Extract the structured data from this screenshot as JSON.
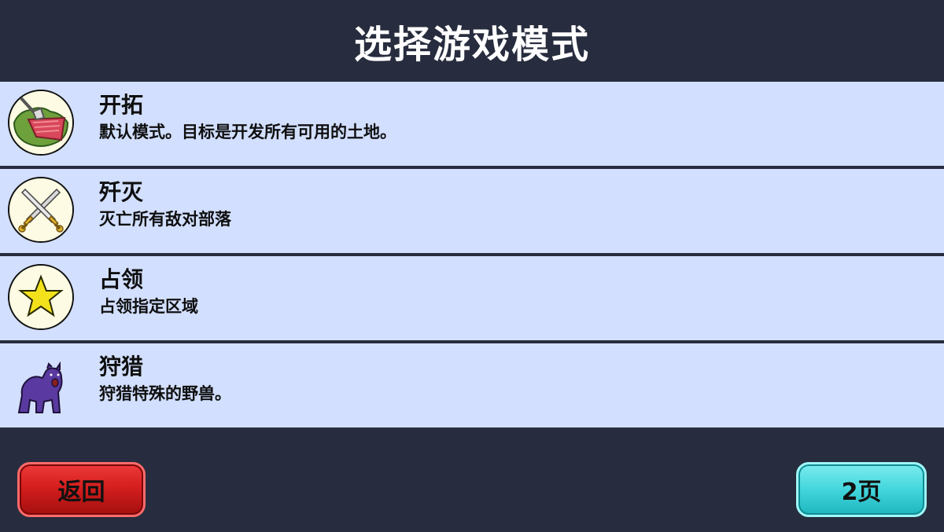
{
  "header": {
    "title": "选择游戏模式"
  },
  "modes": [
    {
      "name": "开拓",
      "description": "默认模式。目标是开发所有可用的土地。",
      "icon": "land-development-icon"
    },
    {
      "name": "歼灭",
      "description": "灭亡所有敌对部落",
      "icon": "crossed-swords-icon"
    },
    {
      "name": "占领",
      "description": "占领指定区域",
      "icon": "star-icon"
    },
    {
      "name": "狩猎",
      "description": "狩猎特殊的野兽。",
      "icon": "bear-icon"
    }
  ],
  "footer": {
    "back_label": "返回",
    "next_page_label": "2页"
  },
  "colors": {
    "background": "#272d3e",
    "row": "#d2dfff",
    "back_button": "#d51e1e",
    "next_button": "#42d6dc"
  }
}
